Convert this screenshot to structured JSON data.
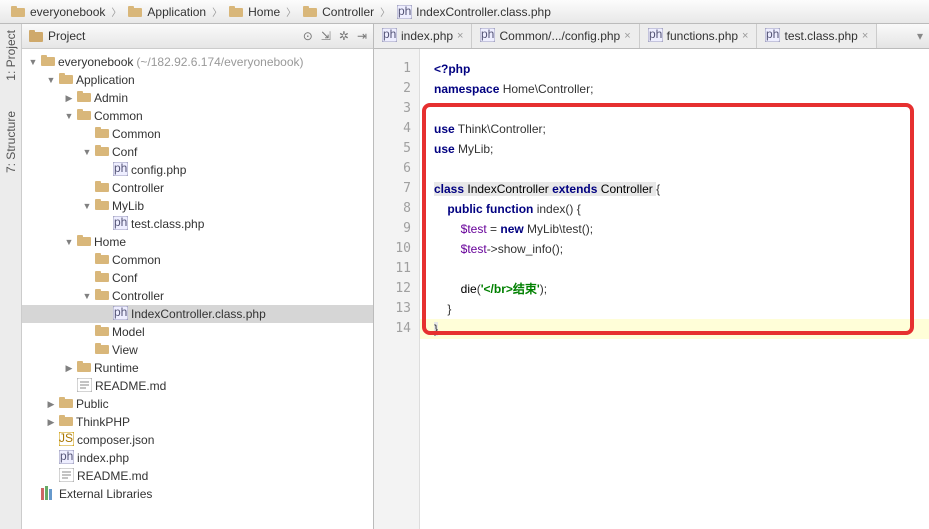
{
  "breadcrumb": [
    {
      "icon": "folder",
      "label": "everyonebook"
    },
    {
      "icon": "folder",
      "label": "Application"
    },
    {
      "icon": "folder",
      "label": "Home"
    },
    {
      "icon": "folder",
      "label": "Controller"
    },
    {
      "icon": "php",
      "label": "IndexController.class.php"
    }
  ],
  "rails": {
    "project": "1: Project",
    "structure": "7: Structure"
  },
  "project_header": {
    "title": "Project"
  },
  "tree": [
    {
      "d": 0,
      "a": "down",
      "i": "folder",
      "t": "everyonebook",
      "s": " (~/182.92.6.174/everyonebook)"
    },
    {
      "d": 1,
      "a": "down",
      "i": "folder",
      "t": "Application"
    },
    {
      "d": 2,
      "a": "right",
      "i": "folder",
      "t": "Admin"
    },
    {
      "d": 2,
      "a": "down",
      "i": "folder",
      "t": "Common"
    },
    {
      "d": 3,
      "a": "",
      "i": "folder",
      "t": "Common"
    },
    {
      "d": 3,
      "a": "down",
      "i": "folder",
      "t": "Conf"
    },
    {
      "d": 4,
      "a": "",
      "i": "php",
      "t": "config.php"
    },
    {
      "d": 3,
      "a": "",
      "i": "folder",
      "t": "Controller"
    },
    {
      "d": 3,
      "a": "down",
      "i": "folder",
      "t": "MyLib"
    },
    {
      "d": 4,
      "a": "",
      "i": "php",
      "t": "test.class.php"
    },
    {
      "d": 2,
      "a": "down",
      "i": "folder",
      "t": "Home"
    },
    {
      "d": 3,
      "a": "",
      "i": "folder",
      "t": "Common"
    },
    {
      "d": 3,
      "a": "",
      "i": "folder",
      "t": "Conf"
    },
    {
      "d": 3,
      "a": "down",
      "i": "folder",
      "t": "Controller"
    },
    {
      "d": 4,
      "a": "",
      "i": "php",
      "t": "IndexController.class.php",
      "sel": true
    },
    {
      "d": 3,
      "a": "",
      "i": "folder",
      "t": "Model"
    },
    {
      "d": 3,
      "a": "",
      "i": "folder",
      "t": "View"
    },
    {
      "d": 2,
      "a": "right",
      "i": "folder",
      "t": "Runtime"
    },
    {
      "d": 2,
      "a": "",
      "i": "md",
      "t": "README.md"
    },
    {
      "d": 1,
      "a": "right",
      "i": "folder",
      "t": "Public"
    },
    {
      "d": 1,
      "a": "right",
      "i": "folder",
      "t": "ThinkPHP"
    },
    {
      "d": 1,
      "a": "",
      "i": "json",
      "t": "composer.json"
    },
    {
      "d": 1,
      "a": "",
      "i": "php",
      "t": "index.php"
    },
    {
      "d": 1,
      "a": "",
      "i": "md",
      "t": "README.md"
    },
    {
      "d": 0,
      "a": "",
      "i": "lib",
      "t": "External Libraries"
    }
  ],
  "tabs": [
    {
      "icon": "php",
      "label": "index.php",
      "active": false
    },
    {
      "icon": "php",
      "label": "Common/.../config.php",
      "active": false
    },
    {
      "icon": "php",
      "label": "functions.php",
      "active": false
    },
    {
      "icon": "php",
      "label": "test.class.php",
      "active": false
    }
  ],
  "code_lines": 14,
  "code": {
    "l1": {
      "open": "<?php"
    },
    "l2": {
      "kw1": "namespace",
      "txt": " Home\\Controller;"
    },
    "l4": {
      "kw1": "use",
      "txt": " Think\\Controller;"
    },
    "l5": {
      "kw1": "use",
      "txt": " MyLib;"
    },
    "l7": {
      "kw1": "class",
      "cls": " IndexController ",
      "kw2": "extends",
      "cls2": " Controller ",
      "br": "{"
    },
    "l8": {
      "indent": "    ",
      "kw1": "public",
      "sp": " ",
      "kw2": "function",
      "fn": " index() {",
      "": ""
    },
    "l9": {
      "indent": "        ",
      "v": "$test",
      "eq": " = ",
      "kw": "new",
      "rest": " MyLib\\test();"
    },
    "l10": {
      "indent": "        ",
      "v": "$test",
      "rest": "->show_info();"
    },
    "l12": {
      "indent": "        ",
      "fn": "die",
      "p": "(",
      "s": "'</br>结束'",
      "e": ");"
    },
    "l13": {
      "indent": "    ",
      "br": "}"
    },
    "l14": {
      "br": "}"
    }
  }
}
